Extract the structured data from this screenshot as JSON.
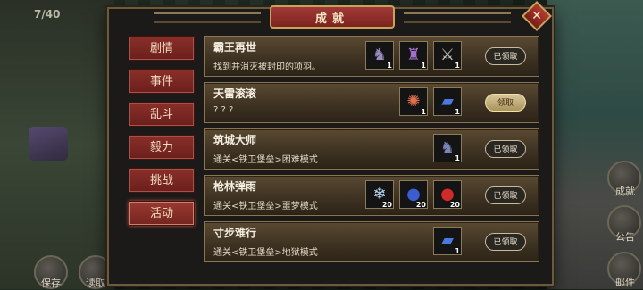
{
  "hud": {
    "counter": "7/40",
    "save_label": "保存",
    "load_label": "读取",
    "right_buttons": [
      "成就",
      "公告",
      "邮件"
    ]
  },
  "dialog": {
    "title": "成就",
    "close_icon": "close-icon"
  },
  "tabs": [
    {
      "label": "剧情",
      "active": false
    },
    {
      "label": "事件",
      "active": false
    },
    {
      "label": "乱斗",
      "active": false
    },
    {
      "label": "毅力",
      "active": false
    },
    {
      "label": "挑战",
      "active": false
    },
    {
      "label": "活动",
      "active": true
    }
  ],
  "achievements": [
    {
      "title": "霸王再世",
      "desc": "找到并消灭被封印的项羽。",
      "rewards": [
        {
          "icon": "warhorse-icon",
          "qty": "1"
        },
        {
          "icon": "armor-icon",
          "qty": "1"
        },
        {
          "icon": "halberd-icon",
          "qty": "1"
        }
      ],
      "claim": "已领取",
      "claimed": true
    },
    {
      "title": "天雷滚滚",
      "desc": "? ? ?",
      "rewards": [
        {
          "icon": "fire-spirit-icon",
          "qty": "1"
        },
        {
          "icon": "scroll-icon",
          "qty": "1"
        }
      ],
      "claim": "领取",
      "claimed": false
    },
    {
      "title": "筑城大师",
      "desc": "通关<铁卫堡垒>困难模式",
      "rewards": [
        {
          "icon": "warhorse-icon",
          "qty": "1"
        }
      ],
      "claim": "已领取",
      "claimed": true
    },
    {
      "title": "枪林弹雨",
      "desc": "通关<铁卫堡垒>噩梦模式",
      "rewards": [
        {
          "icon": "crystal-icon",
          "qty": "20"
        },
        {
          "icon": "blue-gem-icon",
          "qty": "20"
        },
        {
          "icon": "red-gem-icon",
          "qty": "20"
        }
      ],
      "claim": "已领取",
      "claimed": true
    },
    {
      "title": "寸步难行",
      "desc": "通关<铁卫堡垒>地狱模式",
      "rewards": [
        {
          "icon": "scroll-icon",
          "qty": "1"
        }
      ],
      "claim": "已领取",
      "claimed": true
    }
  ]
}
